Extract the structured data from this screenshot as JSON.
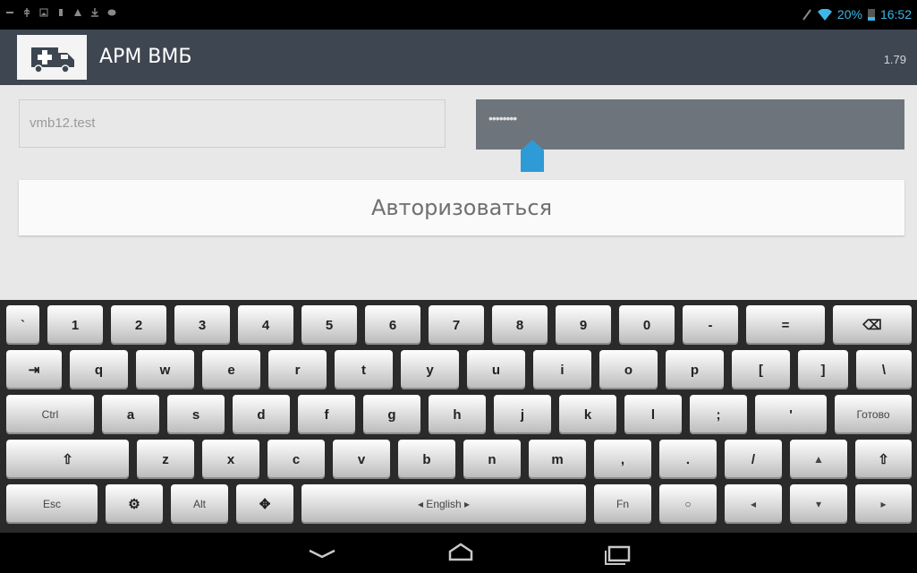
{
  "status_bar": {
    "battery": "20%",
    "time": "16:52",
    "icons": [
      "notification-icon",
      "usb-icon",
      "image-icon",
      "sim-icon",
      "warning-icon",
      "download-icon",
      "chat-icon",
      "signal-icon",
      "wifi-icon",
      "battery-icon"
    ]
  },
  "app_bar": {
    "title": "АРМ ВМБ",
    "version": "1.79",
    "icon": "ambulance-icon"
  },
  "login": {
    "username_value": "vmb12.test",
    "password_masked": "••••••••",
    "submit_label": "Авторизоваться"
  },
  "keyboard": {
    "row1": [
      "`",
      "1",
      "2",
      "3",
      "4",
      "5",
      "6",
      "7",
      "8",
      "9",
      "0",
      "-",
      "=",
      "⌫"
    ],
    "row2": [
      "⇥",
      "q",
      "w",
      "e",
      "r",
      "t",
      "y",
      "u",
      "i",
      "o",
      "p",
      "[",
      "]",
      "\\"
    ],
    "row3": [
      "Ctrl",
      "a",
      "s",
      "d",
      "f",
      "g",
      "h",
      "j",
      "k",
      "l",
      ";",
      "'",
      "Готово"
    ],
    "row4": [
      "⇧",
      "z",
      "x",
      "c",
      "v",
      "b",
      "n",
      "m",
      ",",
      ".",
      "/",
      "▲",
      "⇧"
    ],
    "row5": [
      "Esc",
      "⚙",
      "Alt",
      "✥",
      "◂ English ▸",
      "Fn",
      "○",
      "◂",
      "▾",
      "▸"
    ]
  },
  "nav_bar": {
    "icons": [
      "back-icon",
      "home-icon",
      "recent-apps-icon"
    ]
  },
  "colors": {
    "action_bar": "#3d4651",
    "status_accent": "#3db8e8",
    "content_bg": "#e8e8e8",
    "password_field": "#6d747c"
  }
}
